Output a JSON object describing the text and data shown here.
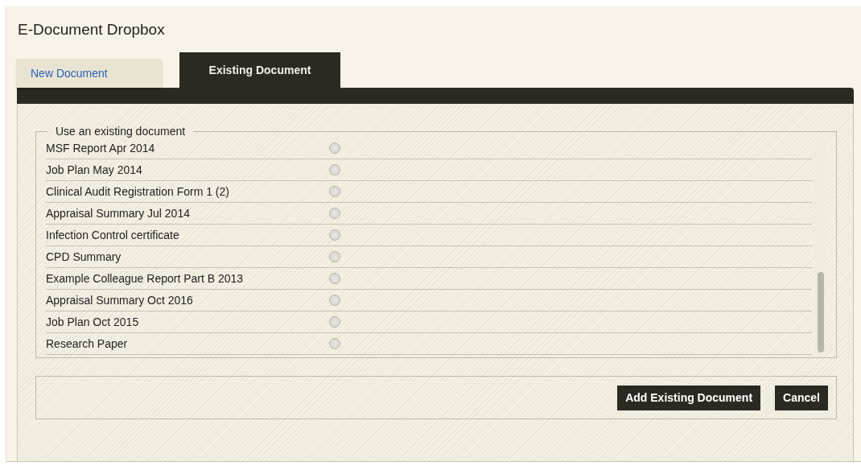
{
  "dialog": {
    "title": "E-Document Dropbox"
  },
  "tabs": [
    {
      "label": "New Document",
      "selected": false
    },
    {
      "label": "Existing Document",
      "selected": true
    }
  ],
  "fieldset": {
    "legend": "Use an existing document"
  },
  "documents": [
    {
      "name": "MSF Report Apr 2014",
      "selected": false
    },
    {
      "name": "Job Plan May 2014",
      "selected": false
    },
    {
      "name": "Clinical Audit Registration Form 1 (2)",
      "selected": false
    },
    {
      "name": "Appraisal Summary Jul 2014",
      "selected": false
    },
    {
      "name": "Infection Control certificate",
      "selected": false
    },
    {
      "name": "CPD Summary",
      "selected": false
    },
    {
      "name": "Example Colleague Report Part B 2013",
      "selected": false
    },
    {
      "name": "Appraisal Summary Oct 2016",
      "selected": false
    },
    {
      "name": "Job Plan Oct 2015",
      "selected": false
    },
    {
      "name": "Research Paper",
      "selected": false
    }
  ],
  "buttons": [
    "Add Existing Document",
    "Cancel"
  ]
}
